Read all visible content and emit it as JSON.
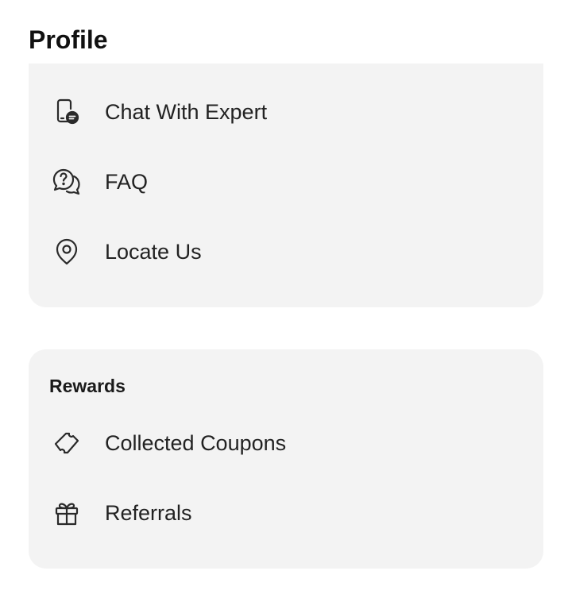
{
  "header": {
    "title": "Profile"
  },
  "support": {
    "items": [
      {
        "label": "Chat With Expert",
        "icon": "chat-expert-icon"
      },
      {
        "label": "FAQ",
        "icon": "faq-icon"
      },
      {
        "label": "Locate Us",
        "icon": "location-pin-icon"
      }
    ]
  },
  "rewards": {
    "heading": "Rewards",
    "items": [
      {
        "label": "Collected Coupons",
        "icon": "coupon-ticket-icon"
      },
      {
        "label": "Referrals",
        "icon": "gift-icon"
      }
    ]
  },
  "theme": {
    "card_background": "#f3f3f3",
    "text": "#1a1a1a",
    "icon_stroke": "#2a2a2a"
  }
}
